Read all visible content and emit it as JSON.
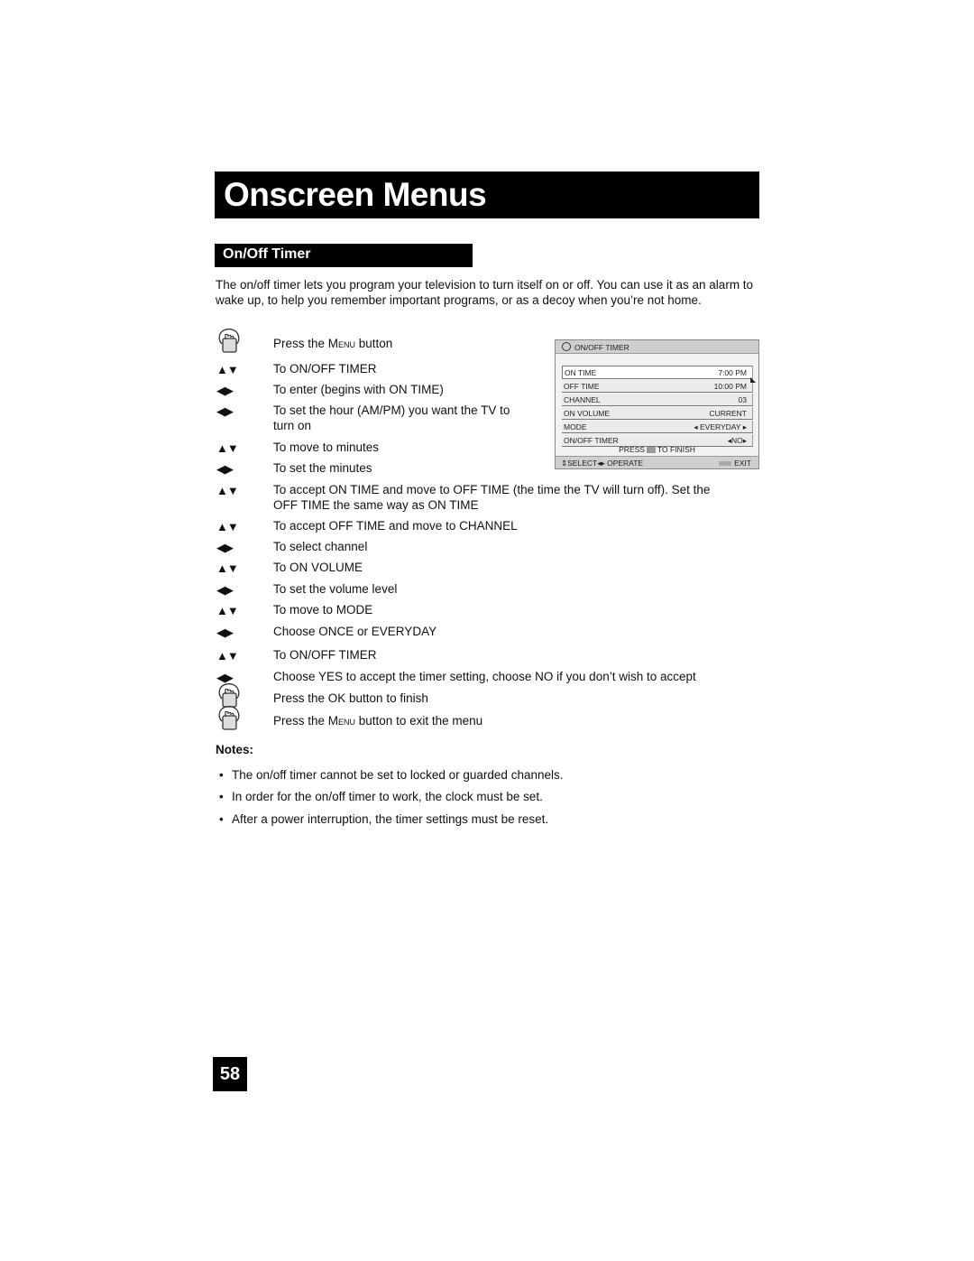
{
  "header": {
    "title": "Onscreen Menus"
  },
  "section": {
    "title": "On/Off Timer"
  },
  "intro": "The on/off timer lets you program your television to turn itself on or off. You can use it as an alarm to wake up, to help you remember important programs, or as a decoy when you’re not home.",
  "steps": [
    {
      "icon": "hand-press-icon",
      "pre": "Press the ",
      "sc": "Menu",
      "post": " button"
    },
    {
      "icon": "up-down-arrows-icon",
      "symbol": "▲▼",
      "text": "To ON/OFF TIMER"
    },
    {
      "icon": "left-right-arrows-icon",
      "symbol": "◀▶",
      "text": "To enter (begins with ON TIME)"
    },
    {
      "icon": "left-right-arrows-icon",
      "symbol": "◀▶",
      "text": "To set the hour (AM/PM) you want the TV to",
      "text2": "turn on"
    },
    {
      "icon": "up-down-arrows-icon",
      "symbol": "▲▼",
      "text": "To move to minutes"
    },
    {
      "icon": "left-right-arrows-icon",
      "symbol": "◀▶",
      "text": "To set the minutes"
    },
    {
      "icon": "up-down-arrows-icon",
      "symbol": "▲▼",
      "text": "To accept ON TIME and move to OFF TIME (the time the TV will turn off). Set the",
      "text2": "OFF TIME the same way as ON TIME"
    },
    {
      "icon": "up-down-arrows-icon",
      "symbol": "▲▼",
      "text": "To accept OFF TIME and move to CHANNEL"
    },
    {
      "icon": "left-right-arrows-icon",
      "symbol": "◀▶",
      "text": "To select channel"
    },
    {
      "icon": "up-down-arrows-icon",
      "symbol": "▲▼",
      "text": "To ON VOLUME"
    },
    {
      "icon": "left-right-arrows-icon",
      "symbol": "◀▶",
      "text": "To set the volume level"
    },
    {
      "icon": "up-down-arrows-icon",
      "symbol": "▲▼",
      "text": "To move to MODE"
    },
    {
      "icon": "left-right-arrows-icon",
      "symbol": "◀▶",
      "text": "Choose ONCE or EVERYDAY"
    },
    {
      "icon": "up-down-arrows-icon",
      "symbol": "▲▼",
      "text": "To ON/OFF TIMER"
    },
    {
      "icon": "left-right-arrows-icon",
      "symbol": "◀▶",
      "text": "Choose YES to accept the timer setting, choose NO if you don’t wish to accept"
    },
    {
      "icon": "hand-press-icon",
      "text": "Press the OK button to finish"
    },
    {
      "icon": "hand-press-icon",
      "pre": "Press the ",
      "sc": "Menu",
      "post": " button to exit the menu"
    }
  ],
  "notes": {
    "heading": "Notes:",
    "bullet": "•",
    "items": [
      "The on/off timer cannot be set to locked or guarded channels.",
      "In order for the on/off timer to work, the clock must be set.",
      "After a power interruption, the timer settings must be reset."
    ]
  },
  "osd": {
    "title": "ON/OFF TIMER",
    "clock_glyph": "◷",
    "rows": [
      {
        "label": "ON TIME",
        "value": "7:00 PM"
      },
      {
        "label": "OFF TIME",
        "value": "10:00 PM"
      },
      {
        "label": "CHANNEL",
        "value": "03"
      },
      {
        "label": "ON VOLUME",
        "value": "CURRENT"
      },
      {
        "label": "MODE",
        "value": "◂ EVERYDAY ▸"
      },
      {
        "label": "ON/OFF TIMER",
        "value": "◂NO▸"
      }
    ],
    "press_pre": "PRESS",
    "press_post": "TO FINISH",
    "footer_left": "⇕SELECT◂▸ OPERATE",
    "footer_right": "EXIT",
    "cursor": "◣"
  },
  "page_number": "58"
}
